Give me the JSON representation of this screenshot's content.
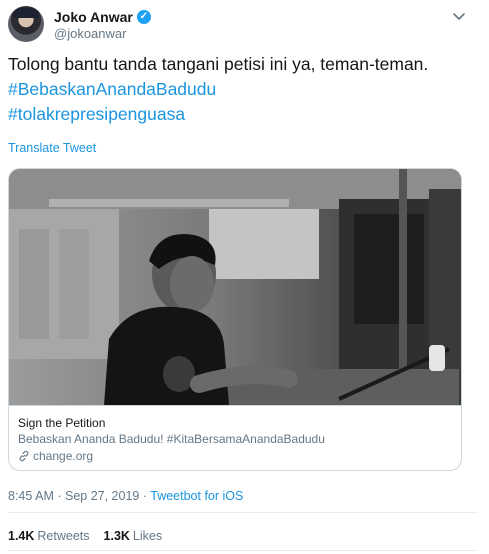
{
  "author": {
    "display_name": "Joko Anwar",
    "handle": "@jokoanwar",
    "verified_icon": "verified-check-icon"
  },
  "tweet": {
    "text": "Tolong bantu tanda tangani petisi ini ya, teman-teman.",
    "hashtags": [
      "#BebaskanAnandaBadudu",
      "#tolakrepresipenguasa"
    ],
    "translate_label": "Translate Tweet"
  },
  "card": {
    "title": "Sign the Petition",
    "description": "Bebaskan Ananda Badudu! #KitaBersamaAnandaBadudu",
    "domain": "change.org",
    "image": "black-and-white-photo-man-speaking-in-studio"
  },
  "meta": {
    "time": "8:45 AM",
    "separator": " · ",
    "date": "Sep 27, 2019",
    "separator2": " · ",
    "via": "Tweetbot for iOS"
  },
  "stats": {
    "retweets_count": "1.4K",
    "retweets_label": "Retweets",
    "likes_count": "1.3K",
    "likes_label": "Likes"
  },
  "colors": {
    "link": "#1b95e0",
    "muted": "#657786",
    "text": "#14171a",
    "border": "#ccd6dd"
  }
}
